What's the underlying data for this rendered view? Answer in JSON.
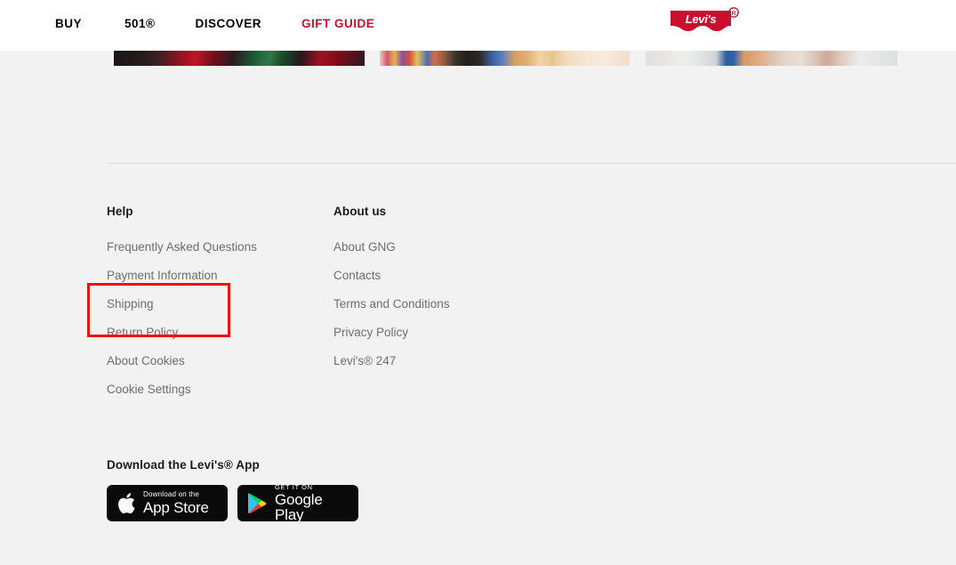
{
  "header": {
    "nav": [
      {
        "label": "BUY",
        "color": "#000000"
      },
      {
        "label": "501®",
        "color": "#000000"
      },
      {
        "label": "DISCOVER",
        "color": "#000000"
      },
      {
        "label": "GIFT GUIDE",
        "color": "#c8102e"
      }
    ],
    "logo": {
      "name": "levis-logo",
      "wordmark": "Levi's",
      "trademark": "®",
      "color": "#c8102e"
    }
  },
  "cards": [
    {
      "name": "promo-card-1"
    },
    {
      "name": "promo-card-2"
    },
    {
      "name": "promo-card-3"
    }
  ],
  "footer": {
    "columns": [
      {
        "title": "Help",
        "links": [
          "Frequently Asked Questions",
          "Payment Information",
          "Shipping",
          "Return Policy",
          "About Cookies",
          "Cookie Settings"
        ]
      },
      {
        "title": "About us",
        "links": [
          "About GNG",
          "Contacts",
          "Terms and Conditions",
          "Privacy Policy",
          "Levi's® 247"
        ]
      }
    ]
  },
  "app": {
    "title": "Download the Levi's® App",
    "badges": [
      {
        "icon": "apple-icon",
        "small_text": "Download on the",
        "big_text": "App Store"
      },
      {
        "icon": "google-play-icon",
        "small_text": "GET IT ON",
        "big_text": "Google Play"
      }
    ]
  },
  "annotation": {
    "name": "highlight-box",
    "color": "#ee1111",
    "targets": [
      "Shipping",
      "Return Policy"
    ]
  },
  "colors": {
    "page_background": "#f2f2f2",
    "header_background": "#ffffff",
    "link_text": "#6e6e6e",
    "heading_text": "#1a1a1a",
    "accent_red": "#c8102e",
    "divider": "#dcdcdc"
  }
}
